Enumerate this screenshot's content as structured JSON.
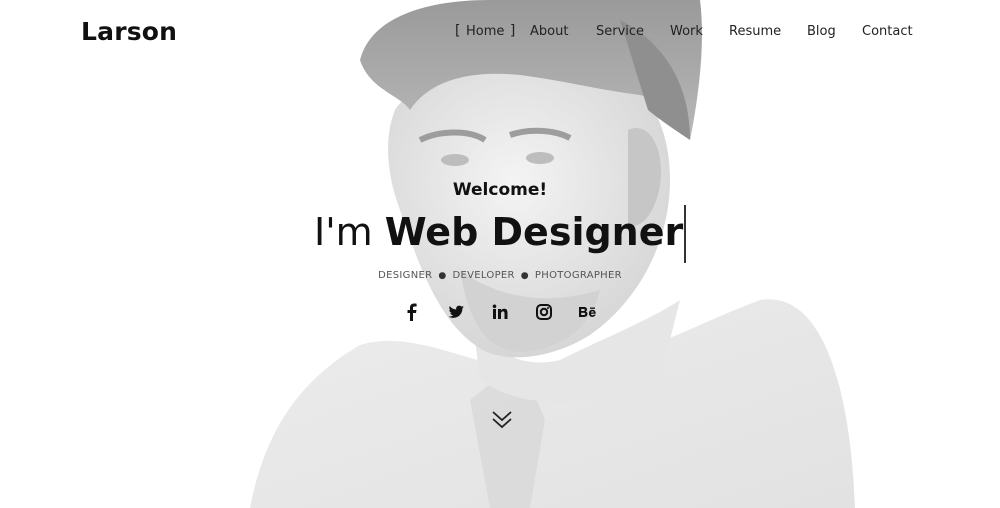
{
  "brand": {
    "logo": "Larson"
  },
  "nav": {
    "items": [
      {
        "label": "Home",
        "active": true
      },
      {
        "label": "About"
      },
      {
        "label": "Service"
      },
      {
        "label": "Work"
      },
      {
        "label": "Resume"
      },
      {
        "label": "Blog"
      },
      {
        "label": "Contact"
      }
    ]
  },
  "hero": {
    "welcome": "Welcome!",
    "prefix": "I'm ",
    "role": "Web Designer",
    "skills": [
      "DESIGNER",
      "DEVELOPER",
      "PHOTOGRAPHER"
    ]
  },
  "social": [
    {
      "icon": "facebook-icon",
      "glyph": "f"
    },
    {
      "icon": "twitter-icon",
      "glyph": ""
    },
    {
      "icon": "linkedin-icon",
      "glyph": "in"
    },
    {
      "icon": "instagram-icon",
      "glyph": ""
    },
    {
      "icon": "behance-icon",
      "glyph": "Bē"
    }
  ],
  "scroll": {
    "icon": "double-chevron-down-icon"
  }
}
